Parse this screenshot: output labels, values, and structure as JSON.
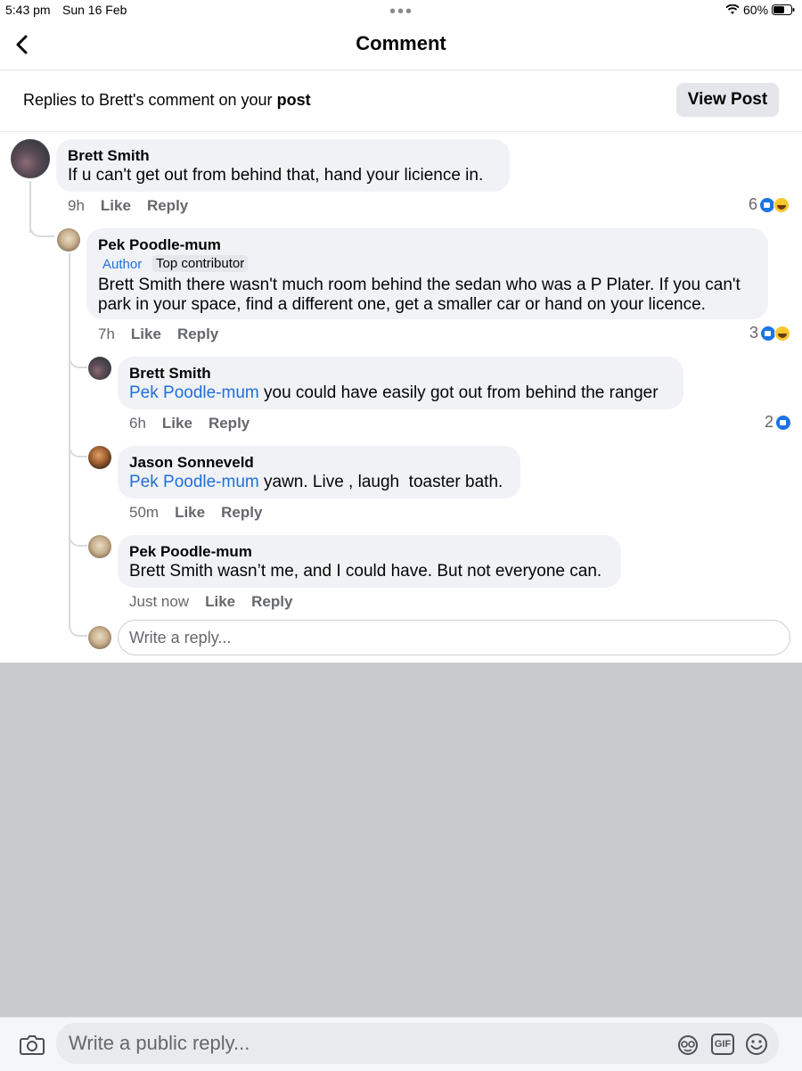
{
  "status_bar": {
    "time": "5:43 pm",
    "date": "Sun 16 Feb",
    "battery": "60%"
  },
  "header": {
    "title": "Comment",
    "back_icon": "chevron-left-icon"
  },
  "context": {
    "text_prefix": "Replies to Brett's comment on your",
    "text_bold": "post",
    "view_post_label": "View Post"
  },
  "comments": [
    {
      "author": "Brett Smith",
      "text": "If u can't get out from behind that, hand your licience in.",
      "time": "9h",
      "like": "Like",
      "reply": "Reply",
      "reactions": "6"
    },
    {
      "author": "Pek Poodle-mum",
      "badge_author": "Author",
      "badge_top": "Top contributor",
      "text_line1": "Brett Smith there wasn't much room behind the sedan who was a P Plater. If you can't",
      "text_line2": "park in your space, find a different one, get a smaller car or hand on your licence.",
      "time": "7h",
      "like": "Like",
      "reply": "Reply",
      "reactions": "3"
    },
    {
      "author": "Brett Smith",
      "mention": "Pek Poodle-mum",
      "text": " you could have easily got out from behind the ranger",
      "time": "6h",
      "like": "Like",
      "reply": "Reply",
      "reactions": "2"
    },
    {
      "author": "Jason Sonneveld",
      "mention": "Pek Poodle-mum",
      "text": " yawn. Live , laugh  toaster bath.",
      "time": "50m",
      "like": "Like",
      "reply": "Reply"
    },
    {
      "author": "Pek Poodle-mum",
      "text": "Brett Smith wasn’t me, and I could have. But not everyone can.",
      "time": "Just now",
      "like": "Like",
      "reply": "Reply"
    }
  ],
  "reply_box": {
    "placeholder": "Write a reply..."
  },
  "bottom_bar": {
    "placeholder": "Write a public reply...",
    "camera_icon": "camera-icon",
    "avatar_sticker_icon": "avatar-sticker-icon",
    "gif_label": "GIF",
    "emoji_icon": "emoji-icon"
  },
  "colors": {
    "accent": "#216fdb",
    "bubble": "#f0f2f5",
    "keyboard_area": "#c9cace"
  }
}
